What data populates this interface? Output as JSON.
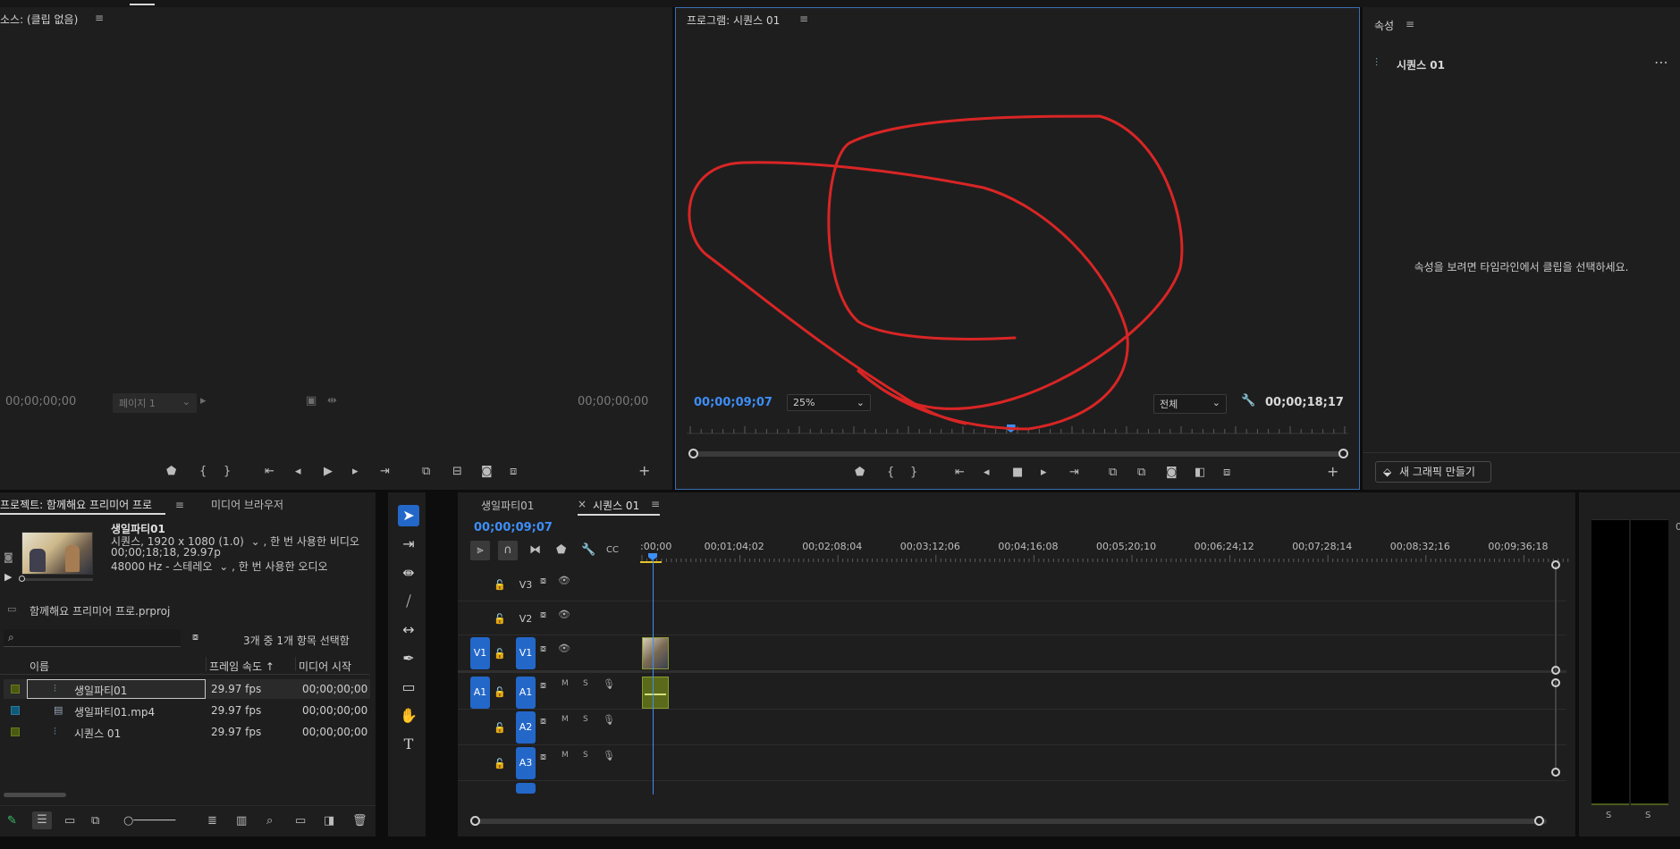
{
  "source_monitor": {
    "title": "소스: (클립 없음)",
    "timecode_left": "00;00;00;00",
    "timecode_right": "00;00;00;00",
    "page_dropdown": "페이지 1",
    "controls": [
      "marker-icon",
      "mark-in-icon",
      "mark-out-icon",
      "go-to-in-icon",
      "step-back-icon",
      "play-icon",
      "step-forward-icon",
      "go-to-out-icon",
      "insert-icon",
      "overwrite-icon",
      "export-frame-icon",
      "button-editor-icon",
      "add-icon"
    ]
  },
  "program_monitor": {
    "title": "프로그램: 시퀀스 01",
    "timecode_current": "00;00;09;07",
    "zoom": "25%",
    "resolution": "전체",
    "timecode_duration": "00;00;18;17",
    "playhead_fraction": 0.49
  },
  "properties": {
    "title": "속성",
    "sequence_name": "시퀀스 01",
    "empty_message": "속성을 보려면 타임라인에서 클립을 선택하세요.",
    "new_graphic_button": "새 그래픽 만들기"
  },
  "project": {
    "tab_project": "프로젝트: 함께해요 프리미어 프로",
    "tab_media_browser": "미디어 브라우저",
    "preview": {
      "name": "생일파티01",
      "line1": "시퀀스, 1920 x 1080 (1.0)",
      "line1_suffix": ", 한 번 사용한 비디오",
      "line2": "00;00;18;18, 29.97p",
      "line3": "48000 Hz - 스테레오",
      "line3_suffix": ", 한 번 사용한 오디오"
    },
    "file_name": "함께해요 프리미어 프로.prproj",
    "selection_status": "3개 중 1개 항목 선택함",
    "columns": [
      "이름",
      "프레임 속도 ↑",
      "미디어 시작"
    ],
    "rows": [
      {
        "name": "생일파티01",
        "fps": "29.97 fps",
        "start": "00;00;00;00",
        "color": "#4a5a10",
        "icon": "sequence-icon",
        "selected": true
      },
      {
        "name": "생일파티01.mp4",
        "fps": "29.97 fps",
        "start": "00;00;00;00",
        "color": "#0f5a7a",
        "icon": "video-clip-icon",
        "selected": false
      },
      {
        "name": "시퀀스 01",
        "fps": "29.97 fps",
        "start": "00;00;00;00",
        "color": "#4a5a10",
        "icon": "sequence-icon",
        "selected": false
      }
    ]
  },
  "timeline": {
    "tab1": "생일파티01",
    "tab2_close": "×",
    "tab2": "시퀀스 01",
    "timecode": "00;00;09;07",
    "ruler_labels": [
      ":00;00",
      "00;01;04;02",
      "00;02;08;04",
      "00;03;12;06",
      "00;04;16;08",
      "00;05;20;10",
      "00;06;24;12",
      "00;07;28;14",
      "00;08;32;16",
      "00;09;36;18"
    ],
    "video_tracks": [
      {
        "label": "V3",
        "source": ""
      },
      {
        "label": "V2",
        "source": ""
      },
      {
        "label": "V1",
        "source": "V1"
      }
    ],
    "audio_tracks": [
      {
        "label": "A1",
        "source": "A1"
      },
      {
        "label": "A2",
        "source": ""
      },
      {
        "label": "A3",
        "source": ""
      }
    ],
    "mute_label": "M",
    "solo_label": "S"
  },
  "audio_meter": {
    "solo_left": "S",
    "solo_right": "S",
    "top_label": "0"
  },
  "colors": {
    "accent": "#3e8ef7",
    "track_button": "#2367c9",
    "annotation": "#d92525",
    "panel_bg": "#1e1e1e"
  }
}
